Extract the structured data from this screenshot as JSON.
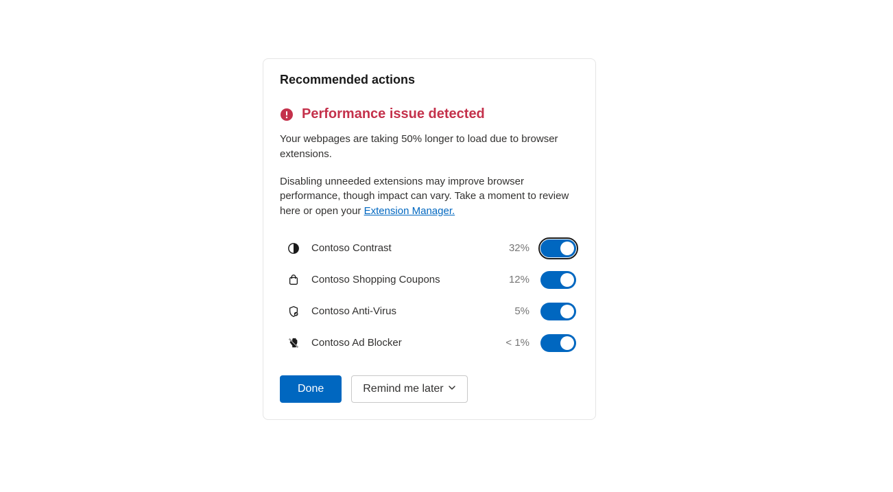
{
  "card": {
    "title": "Recommended actions",
    "alert_title": "Performance issue detected",
    "body_1": "Your webpages are taking 50% longer to load due to browser extensions.",
    "body_2_prefix": "Disabling unneeded extensions may improve browser performance, though impact can vary. Take a moment to review here or open your ",
    "body_2_link": "Extension Manager.",
    "extensions": [
      {
        "name": "Contoso Contrast",
        "impact": "32%",
        "icon": "contrast-icon",
        "on": true,
        "focused": true
      },
      {
        "name": "Contoso Shopping Coupons",
        "impact": "12%",
        "icon": "shopping-icon",
        "on": true,
        "focused": false
      },
      {
        "name": "Contoso Anti-Virus",
        "impact": "5%",
        "icon": "shield-icon",
        "on": true,
        "focused": false
      },
      {
        "name": "Contoso Ad Blocker",
        "impact": "< 1%",
        "icon": "block-icon",
        "on": true,
        "focused": false
      }
    ],
    "buttons": {
      "done": "Done",
      "remind": "Remind me later"
    }
  },
  "colors": {
    "accent": "#0067c0",
    "danger": "#c4314b"
  }
}
